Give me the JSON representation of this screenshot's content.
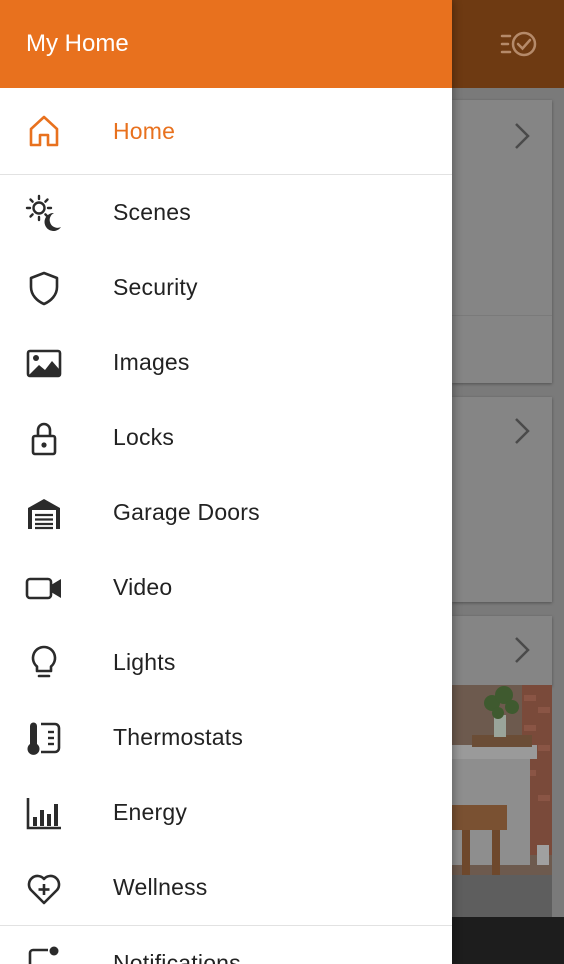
{
  "app": {
    "title": "My Home",
    "accent": "#e8711e"
  },
  "nav": {
    "items": [
      {
        "label": "Home",
        "icon": "home-icon",
        "active": true
      },
      {
        "label": "Scenes",
        "icon": "scenes-icon"
      },
      {
        "label": "Security",
        "icon": "shield-icon"
      },
      {
        "label": "Images",
        "icon": "image-icon"
      },
      {
        "label": "Locks",
        "icon": "lock-icon"
      },
      {
        "label": "Garage Doors",
        "icon": "garage-icon"
      },
      {
        "label": "Video",
        "icon": "video-camera-icon"
      },
      {
        "label": "Lights",
        "icon": "lightbulb-icon"
      },
      {
        "label": "Thermostats",
        "icon": "thermostat-icon"
      },
      {
        "label": "Energy",
        "icon": "energy-chart-icon"
      },
      {
        "label": "Wellness",
        "icon": "heart-plus-icon"
      },
      {
        "label": "Notifications",
        "icon": "notifications-icon"
      }
    ]
  },
  "background": {
    "action_icon": "checklist-icon",
    "chevron_icon": "chevron-right-icon"
  }
}
